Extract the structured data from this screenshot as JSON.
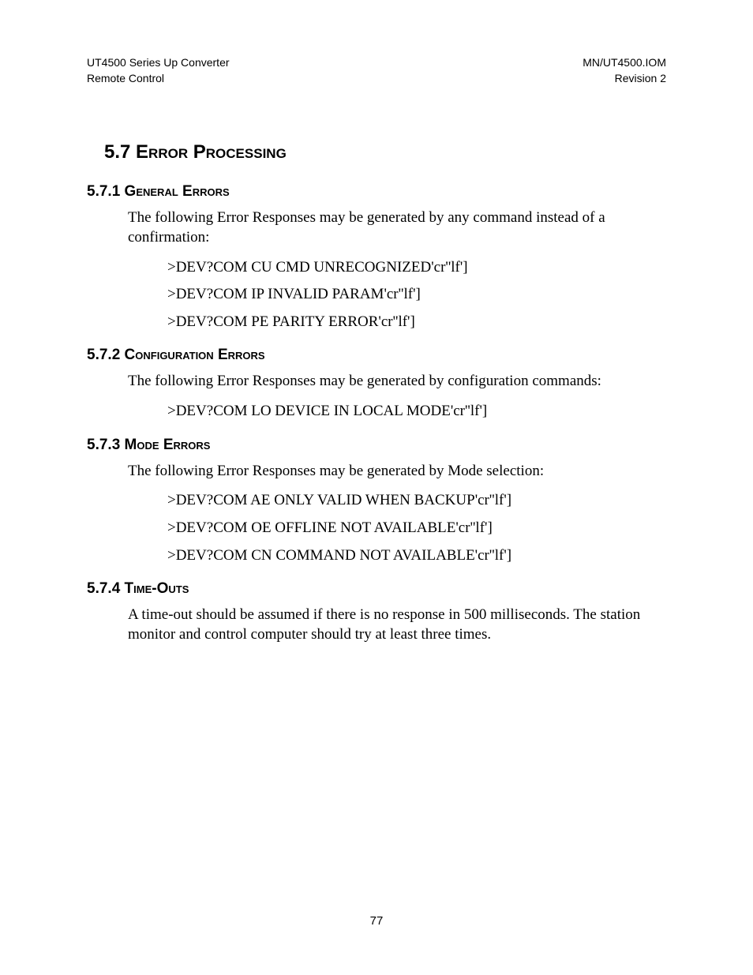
{
  "header": {
    "leftLine1": "UT4500 Series Up Converter",
    "leftLine2": "Remote Control",
    "rightLine1": "MN/UT4500.IOM",
    "rightLine2": "Revision 2"
  },
  "main": {
    "heading": {
      "number": "5.7",
      "title": "Error Processing"
    },
    "subsections": [
      {
        "number": "5.7.1",
        "title": "General Errors",
        "intro": "The following Error Responses may be generated by any command instead of a confirmation:",
        "lines": [
          ">DEV?COM CU CMD UNRECOGNIZED'cr''lf']",
          ">DEV?COM IP INVALID PARAM'cr''lf']",
          ">DEV?COM PE PARITY ERROR'cr''lf']"
        ]
      },
      {
        "number": "5.7.2",
        "title": "Configuration Errors",
        "intro": "The following Error Responses may be generated by configuration commands:",
        "lines": [
          ">DEV?COM LO DEVICE IN LOCAL MODE'cr''lf']"
        ]
      },
      {
        "number": "5.7.3",
        "title": "Mode Errors",
        "intro": "The following Error Responses may be generated by Mode selection:",
        "lines": [
          ">DEV?COM AE ONLY VALID WHEN BACKUP'cr''lf']",
          ">DEV?COM OE OFFLINE NOT AVAILABLE'cr''lf']",
          ">DEV?COM CN COMMAND NOT AVAILABLE'cr''lf']"
        ]
      },
      {
        "number": "5.7.4",
        "title": "Time-Outs",
        "intro": "A time-out should be assumed if there is no response in 500 milliseconds.  The station monitor and control computer should try at least three times.",
        "lines": []
      }
    ]
  },
  "pageNumber": "77"
}
